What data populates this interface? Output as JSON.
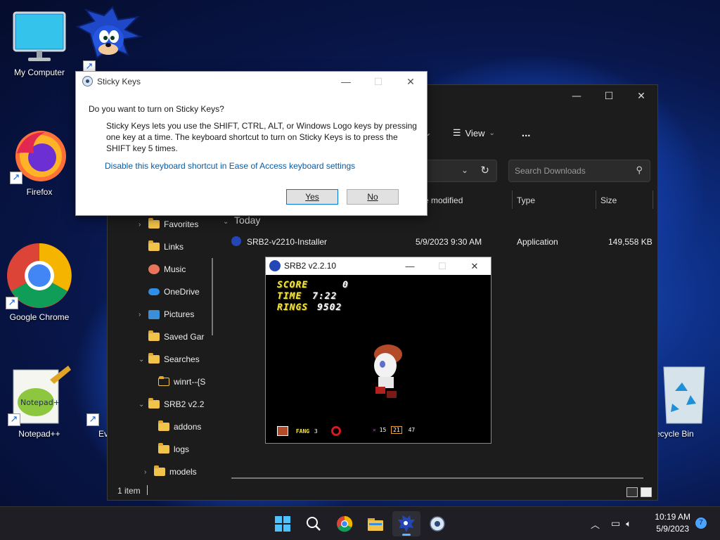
{
  "desktop": {
    "icons": [
      {
        "label": "My Computer"
      },
      {
        "label": "Firefox"
      },
      {
        "label": "Google Chrome"
      },
      {
        "label": "Notepad++"
      },
      {
        "label": "Ev"
      },
      {
        "label": "ecycle Bin"
      }
    ]
  },
  "sticky_keys": {
    "title": "Sticky Keys",
    "question": "Do you want to turn on Sticky Keys?",
    "body": "Sticky Keys lets you use the SHIFT, CTRL, ALT, or Windows Logo keys by pressing one key at a time. The keyboard shortcut to turn on Sticky Keys is to press the SHIFT key 5 times.",
    "link": "Disable this keyboard shortcut in Ease of Access keyboard settings",
    "yes_label": "Yes",
    "no_label": "No"
  },
  "explorer": {
    "toolbar": {
      "view_label": "View",
      "more_label": "..."
    },
    "search_placeholder": "Search Downloads",
    "columns": {
      "date": "e modified",
      "type": "Type",
      "size": "Size"
    },
    "group": "Today",
    "file": {
      "name": "SRB2-v2210-Installer",
      "date": "5/9/2023 9:30 AM",
      "type": "Application",
      "size": "149,558 KB"
    },
    "nav": [
      {
        "label": "Favorites"
      },
      {
        "label": "Links"
      },
      {
        "label": "Music"
      },
      {
        "label": "OneDrive"
      },
      {
        "label": "Pictures"
      },
      {
        "label": "Saved Gar"
      },
      {
        "label": "Searches"
      },
      {
        "label": "winrt--{S"
      },
      {
        "label": "SRB2 v2.2"
      },
      {
        "label": "addons"
      },
      {
        "label": "logs"
      },
      {
        "label": "models"
      }
    ],
    "status": "1 item"
  },
  "srb2": {
    "title": "SRB2 v2.2.10",
    "hud": {
      "score_label": "SCORE",
      "score": "0",
      "time_label": "TIME",
      "time": "7:22",
      "rings_label": "RINGS",
      "rings": "9502"
    },
    "bottom": {
      "character": "FANG",
      "lives": "3",
      "a": "15",
      "b": "21",
      "c": "47"
    }
  },
  "taskbar": {
    "time": "10:19 AM",
    "date": "5/9/2023",
    "notifications": "7"
  },
  "colors": {
    "accent": "#60b4ff",
    "hud_yellow": "#f2e640",
    "link": "#0b5aa3"
  }
}
